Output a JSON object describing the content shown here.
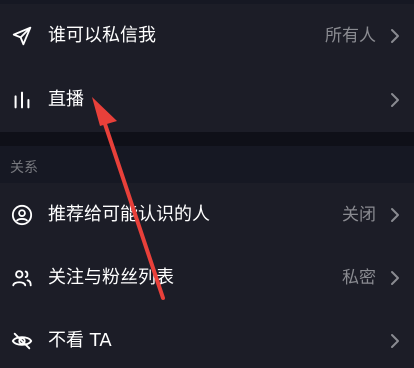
{
  "settings": {
    "dm_row": {
      "label": "谁可以私信我",
      "value": "所有人"
    },
    "live_row": {
      "label": "直播"
    },
    "relations_section": {
      "title": "关系"
    },
    "recommend_row": {
      "label": "推荐给可能认识的人",
      "value": "关闭"
    },
    "follow_list_row": {
      "label": "关注与粉丝列表",
      "value": "私密"
    },
    "hide_row": {
      "label": "不看 TA"
    }
  },
  "colors": {
    "background": "#161823",
    "row_background": "#1c1d27",
    "divider": "#0f1018",
    "text_primary": "#ffffff",
    "text_secondary": "#8a8b91",
    "annotation_arrow": "#e8403a"
  },
  "icons": {
    "dm_row": "send-icon",
    "live_row": "bar-chart-icon",
    "recommend_row": "user-circle-icon",
    "follow_list_row": "users-icon",
    "hide_row": "eye-slash-icon",
    "chevrons": "chevron-right-icon"
  }
}
